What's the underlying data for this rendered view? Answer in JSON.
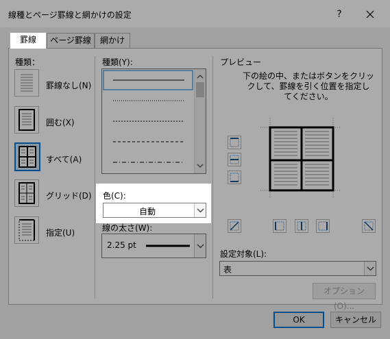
{
  "window": {
    "title": "線種とページ罫線と網かけの設定",
    "help_label": "?"
  },
  "tabs": [
    {
      "label": "罫線",
      "active": true
    },
    {
      "label": "ページ罫線",
      "active": false
    },
    {
      "label": "網かけ",
      "active": false
    }
  ],
  "settings": {
    "heading": "種類：",
    "items": [
      {
        "label": "罫線なし(N)"
      },
      {
        "label": "囲む(X)"
      },
      {
        "label": "すべて(A)",
        "selected": true
      },
      {
        "label": "グリッド(D)"
      },
      {
        "label": "指定(U)"
      }
    ]
  },
  "style": {
    "heading": "種類(Y):",
    "line_styles": [
      "solid",
      "dotted",
      "dashed-small",
      "dashed",
      "dash-dot"
    ],
    "color_label": "色(C):",
    "color_value": "自動",
    "width_label": "線の太さ(W):",
    "width_value": "2.25 pt"
  },
  "preview": {
    "heading": "プレビュー",
    "instructions": "下の絵の中、またはボタンを使用して、罫線を引く位置を指定してください。",
    "instruction_lines": [
      "下の絵の中、またはボタンをクリッ",
      "クして、罫線を引く位置を指定し",
      "てください。"
    ],
    "apply_to_label": "設定対象(L):",
    "apply_to_value": "表",
    "options_button": "オプション(O)..."
  },
  "buttons": {
    "ok": "OK",
    "cancel": "キャンセル"
  },
  "colors": {
    "accent": "#0078d7",
    "selected_fill": "#cce4f7"
  }
}
